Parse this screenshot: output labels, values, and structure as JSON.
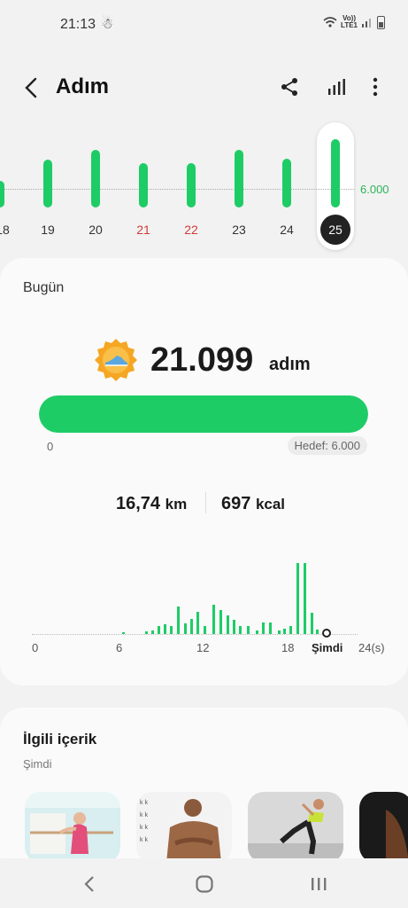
{
  "status_bar": {
    "time": "21:13",
    "network_top": "Vo))",
    "network_bottom": "LTE1"
  },
  "header": {
    "title": "Adım",
    "icons": [
      "back-arrow-icon",
      "share-icon",
      "bar-chart-icon",
      "more-vert-icon"
    ]
  },
  "week_chart": {
    "goal_label": "6.000",
    "days": [
      {
        "label": "18",
        "weekend": false,
        "selected": false
      },
      {
        "label": "19",
        "weekend": false,
        "selected": false
      },
      {
        "label": "20",
        "weekend": false,
        "selected": false
      },
      {
        "label": "21",
        "weekend": true,
        "selected": false
      },
      {
        "label": "22",
        "weekend": true,
        "selected": false
      },
      {
        "label": "23",
        "weekend": false,
        "selected": false
      },
      {
        "label": "24",
        "weekend": false,
        "selected": false
      },
      {
        "label": "25",
        "weekend": false,
        "selected": true
      }
    ]
  },
  "today": {
    "label": "Bugün",
    "steps": "21.099",
    "steps_unit": "adım",
    "progress_fraction": 1.0,
    "progress_start": "0",
    "goal_text": "Hedef: 6.000",
    "distance": "16,74",
    "distance_unit": "km",
    "calories": "697",
    "calories_unit": "kcal",
    "hourly_axis": [
      "0",
      "6",
      "12",
      "18",
      "Şimdi",
      "24(s)"
    ]
  },
  "related": {
    "title": "İlgili içerik",
    "subtitle": "Şimdi",
    "thumbnails": [
      "yoga-stretch-image",
      "bodybuilder-image",
      "lunge-exercise-image",
      "fitness-image"
    ]
  },
  "colors": {
    "accent": "#1ecc66",
    "weekend": "#d33a3a",
    "background": "#f2f2f2",
    "card": "#fafafa"
  }
}
